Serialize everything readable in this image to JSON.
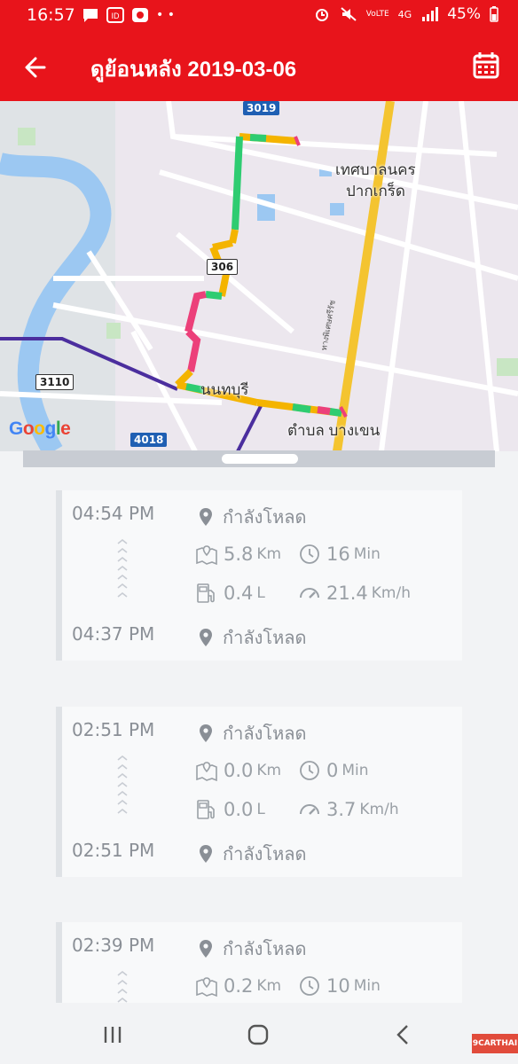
{
  "status_bar": {
    "time": "16:57",
    "battery": "45%",
    "network": "4G",
    "volte": "VoLTE"
  },
  "app_bar": {
    "title": "ดูย้อนหลัง 2019-03-06",
    "back_icon": "arrow-left-icon",
    "calendar_icon": "calendar-icon",
    "color": "#e8141b"
  },
  "map": {
    "labels": {
      "district_line1": "เทศบาลนคร",
      "district_line2": "ปากเกร็ด",
      "city": "นนทบุรี",
      "subdistrict": "ตำบล บางเขน",
      "road_vertical": "ทางพิเศษศรีรัช"
    },
    "shields": {
      "r3019": "3019",
      "r306": "306",
      "r3110": "3110",
      "r4018": "4018"
    },
    "provider": "Google"
  },
  "trips": [
    {
      "start_time": "04:54 PM",
      "start_location": "กำลังโหลด",
      "distance": "5.8",
      "distance_unit": "Km",
      "duration": "16",
      "duration_unit": "Min",
      "fuel": "0.4",
      "fuel_unit": "L",
      "speed": "21.4",
      "speed_unit": "Km/h",
      "end_time": "04:37 PM",
      "end_location": "กำลังโหลด"
    },
    {
      "start_time": "02:51 PM",
      "start_location": "กำลังโหลด",
      "distance": "0.0",
      "distance_unit": "Km",
      "duration": "0",
      "duration_unit": "Min",
      "fuel": "0.0",
      "fuel_unit": "L",
      "speed": "3.7",
      "speed_unit": "Km/h",
      "end_time": "02:51 PM",
      "end_location": "กำลังโหลด"
    },
    {
      "start_time": "02:39 PM",
      "start_location": "กำลังโหลด",
      "distance": "0.2",
      "distance_unit": "Km",
      "duration": "10",
      "duration_unit": "Min"
    }
  ],
  "nav_bar": {
    "recent_icon": "recent-apps-icon",
    "home_icon": "home-icon",
    "back_icon": "back-chevron-icon"
  },
  "watermark": "9CARTHAI"
}
